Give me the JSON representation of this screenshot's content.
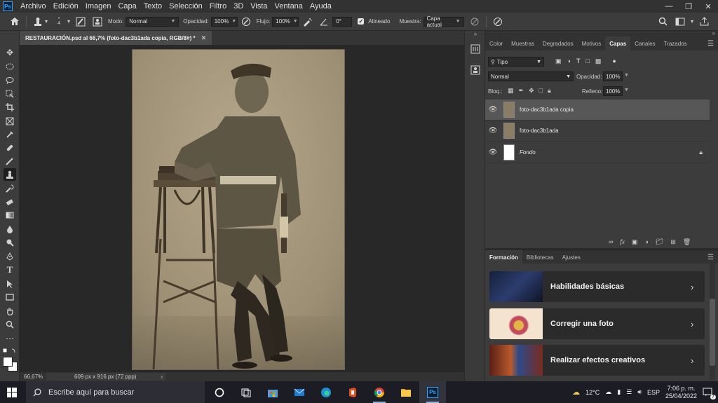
{
  "menubar": {
    "app_logo": "Ps",
    "items": [
      "Archivo",
      "Edición",
      "Imagen",
      "Capa",
      "Texto",
      "Selección",
      "Filtro",
      "3D",
      "Vista",
      "Ventana",
      "Ayuda"
    ],
    "window_controls": [
      "minimize-icon",
      "restore-icon",
      "close-icon"
    ]
  },
  "options": {
    "brush_size": "4",
    "mode_label": "Modo:",
    "mode_value": "Normal",
    "opacity_label": "Opacidad:",
    "opacity_value": "100%",
    "flow_label": "Flujo:",
    "flow_value": "100%",
    "angle_value": "0°",
    "aligned_label": "Alineado",
    "aligned_checked": true,
    "sample_label": "Muestra:",
    "sample_value": "Capa actual"
  },
  "document": {
    "tab_title": "RESTAURACIÓN.psd al 66,7% (foto-dac3b1ada copia, RGB/8#) *",
    "zoom": "66,67%",
    "doc_info": "609 px x 916 px (72 ppp)"
  },
  "panel_tabs": [
    "Color",
    "Muestras",
    "Degradados",
    "Motivos",
    "Capas",
    "Canales",
    "Trazados"
  ],
  "panel_tabs_active": "Capas",
  "layers_panel": {
    "filter_label": "Tipo",
    "blend_mode": "Normal",
    "opacity_label": "Opacidad:",
    "opacity_value": "100%",
    "lock_label": "Bloq.:",
    "fill_label": "Relleno:",
    "fill_value": "100%",
    "layers": [
      {
        "name": "foto-dac3b1ada copia",
        "selected": true,
        "locked": false,
        "italic": false
      },
      {
        "name": "foto-dac3b1ada",
        "selected": false,
        "locked": false,
        "italic": false
      },
      {
        "name": "Fondo",
        "selected": false,
        "locked": true,
        "italic": true
      }
    ]
  },
  "learn_panel": {
    "tabs": [
      "Formación",
      "Bibliotecas",
      "Ajustes"
    ],
    "active_tab": "Formación",
    "cards": [
      "Habilidades básicas",
      "Corregir una foto",
      "Realizar efectos creativos"
    ]
  },
  "taskbar": {
    "search_placeholder": "Escribe aquí para buscar",
    "apps": [
      "cortana-icon",
      "task-view-icon",
      "store-icon",
      "mail-icon",
      "edge-icon",
      "office-icon",
      "chrome-icon",
      "file-explorer-icon",
      "photoshop-icon"
    ],
    "weather": "12°C",
    "language": "ESP",
    "time": "7:06 p. m.",
    "date": "25/04/2022",
    "notifications": "7"
  },
  "colors": {
    "accent": "#31a8ff",
    "photo_sepia": "#a89a7e"
  }
}
